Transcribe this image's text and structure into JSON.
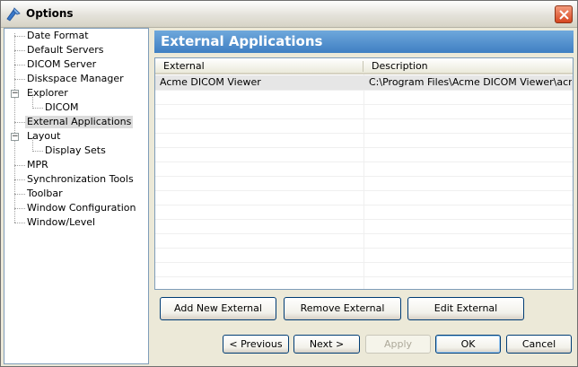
{
  "window": {
    "title": "Options",
    "colors": {
      "accent": "#3f7fc3",
      "selection": "#dcdcdc"
    }
  },
  "tree": {
    "items": [
      {
        "label": "Date Format"
      },
      {
        "label": "Default Servers"
      },
      {
        "label": "DICOM Server"
      },
      {
        "label": "Diskspace Manager"
      },
      {
        "label": "Explorer",
        "expanded": true
      },
      {
        "label": "DICOM"
      },
      {
        "label": "External Applications",
        "selected": true
      },
      {
        "label": "Layout",
        "expanded": true
      },
      {
        "label": "Display Sets"
      },
      {
        "label": "MPR"
      },
      {
        "label": "Synchronization Tools"
      },
      {
        "label": "Toolbar"
      },
      {
        "label": "Window Configuration"
      },
      {
        "label": "Window/Level"
      }
    ],
    "expander_symbol": "−"
  },
  "panel": {
    "title": "External Applications"
  },
  "table": {
    "columns": [
      "External",
      "Description"
    ],
    "rows": [
      {
        "external": "Acme DICOM Viewer",
        "description": "C:\\Program Files\\Acme DICOM Viewer\\acm..."
      }
    ]
  },
  "buttons": {
    "add": "Add New External",
    "remove": "Remove External",
    "edit": "Edit External",
    "previous": "< Previous",
    "next": "Next >",
    "apply": "Apply",
    "ok": "OK",
    "cancel": "Cancel"
  }
}
